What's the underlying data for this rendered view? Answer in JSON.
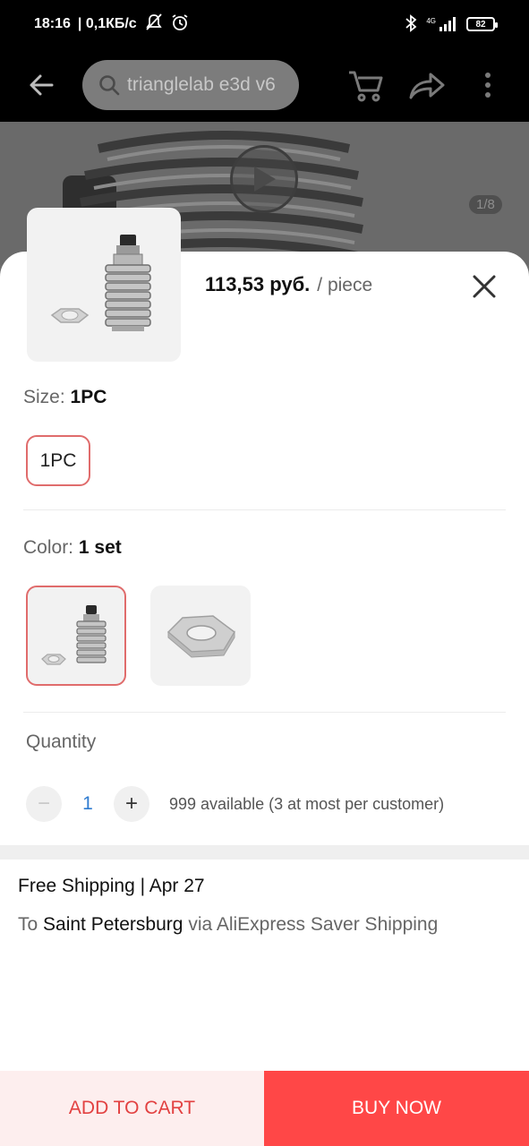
{
  "status_bar": {
    "time": "18:16",
    "speed": "| 0,1КБ/с",
    "network": "4G",
    "battery": "82"
  },
  "nav": {
    "search_value": "trianglelab e3d v6",
    "icons": [
      "back-arrow-icon",
      "search-icon",
      "cart-icon",
      "share-icon",
      "more-icon"
    ]
  },
  "gallery": {
    "counter": "1/8"
  },
  "product": {
    "price": "113,53 руб.",
    "unit": "/ piece"
  },
  "size": {
    "label": "Size:",
    "selected": "1PC",
    "options": [
      "1PC"
    ]
  },
  "color": {
    "label": "Color:",
    "selected": "1 set"
  },
  "quantity": {
    "label": "Quantity",
    "minus": "−",
    "value": "1",
    "plus": "+",
    "available": "999 available (3 at most per customer)"
  },
  "shipping": {
    "line1": "Free Shipping | Apr 27",
    "to": "To",
    "city": "Saint Petersburg",
    "via": "via AliExpress Saver Shipping"
  },
  "actions": {
    "add_to_cart": "ADD TO CART",
    "buy_now": "BUY NOW"
  },
  "colors": {
    "accent": "#ff4747",
    "accent_light": "#fdeeee",
    "selected_border": "#e06c6c",
    "qty_value": "#2e7bd0"
  }
}
